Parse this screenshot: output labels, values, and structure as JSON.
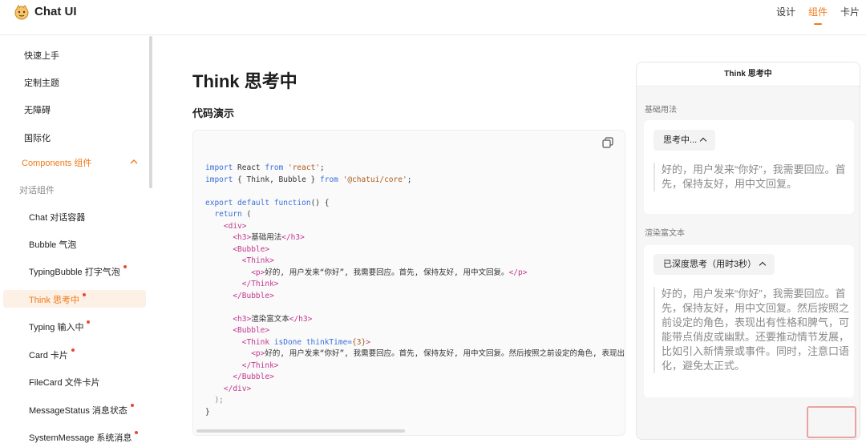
{
  "header": {
    "brand": "Chat UI",
    "nav": [
      {
        "label": "设计",
        "active": false
      },
      {
        "label": "组件",
        "active": true
      },
      {
        "label": "卡片",
        "active": false
      }
    ]
  },
  "sidebar": {
    "items": [
      {
        "label": "快速上手"
      },
      {
        "label": "定制主题"
      },
      {
        "label": "无障碍"
      },
      {
        "label": "国际化"
      },
      {
        "label": "Components 组件"
      },
      {
        "label": "对话组件"
      },
      {
        "label": "Chat 对话容器"
      },
      {
        "label": "Bubble 气泡"
      },
      {
        "label": "TypingBubble 打字气泡"
      },
      {
        "label": "Think 思考中"
      },
      {
        "label": "Typing 输入中"
      },
      {
        "label": "Card 卡片"
      },
      {
        "label": "FileCard 文件卡片"
      },
      {
        "label": "MessageStatus 消息状态"
      },
      {
        "label": "SystemMessage 系统消息"
      }
    ]
  },
  "main": {
    "title": "Think 思考中",
    "section_title": "代码演示"
  },
  "code": {
    "l1_kw": "import",
    "l1_a": " React ",
    "l1_kw2": "from",
    "l1_str": " 'react'",
    "l1_end": ";",
    "l2_kw": "import",
    "l2_a": " { Think, Bubble } ",
    "l2_kw2": "from",
    "l2_str": " '@chatui/core'",
    "l2_end": ";",
    "l4_kw": "export default function",
    "l4_end": "() {",
    "l5_kw": "  return",
    "l5_end": " (",
    "l6": "    <div>",
    "l7_t1": "      <h3>",
    "l7_txt": "基础用法",
    "l7_t2": "</h3>",
    "l8": "      <Bubble>",
    "l9": "        <Think>",
    "l10_t1": "          <p>",
    "l10_txt": "好的, 用户发来“你好”, 我需要回应。首先, 保持友好, 用中文回复。",
    "l10_t2": "</p>",
    "l11": "        </Think>",
    "l12": "      </Bubble>",
    "l14_t1": "      <h3>",
    "l14_txt": "渲染富文本",
    "l14_t2": "</h3>",
    "l15": "      <Bubble>",
    "l16_t1": "        <Think",
    "l16_a": " isDone thinkTime=",
    "l16_v": "{3}",
    "l16_t2": ">",
    "l17_t1": "          <p>",
    "l17_txt": "好的, 用户发来“你好”, 我需要回应。首先, 保持友好, 用中文回复。然后按照之前设定的角色, 表现出",
    "l18": "        </Think>",
    "l19": "      </Bubble>",
    "l20": "    </div>",
    "l21": "  );",
    "l22": "}"
  },
  "preview": {
    "title": "Think 思考中",
    "section1_label": "基础用法",
    "section1_chip": "思考中...",
    "section1_text": "好的，用户发来“你好”，我需要回应。首先，保持友好，用中文回复。",
    "section2_label": "渲染富文本",
    "section2_chip": "已深度思考（用时3秒）",
    "section2_text": "好的，用户发来“你好”，我需要回应。首先，保持友好，用中文回复。然后按照之前设定的角色，表现出有性格和脾气，可能带点俏皮或幽默。还要推动情节发展，比如引入新情景或事件。同时，注意口语化，避免太正式。"
  }
}
